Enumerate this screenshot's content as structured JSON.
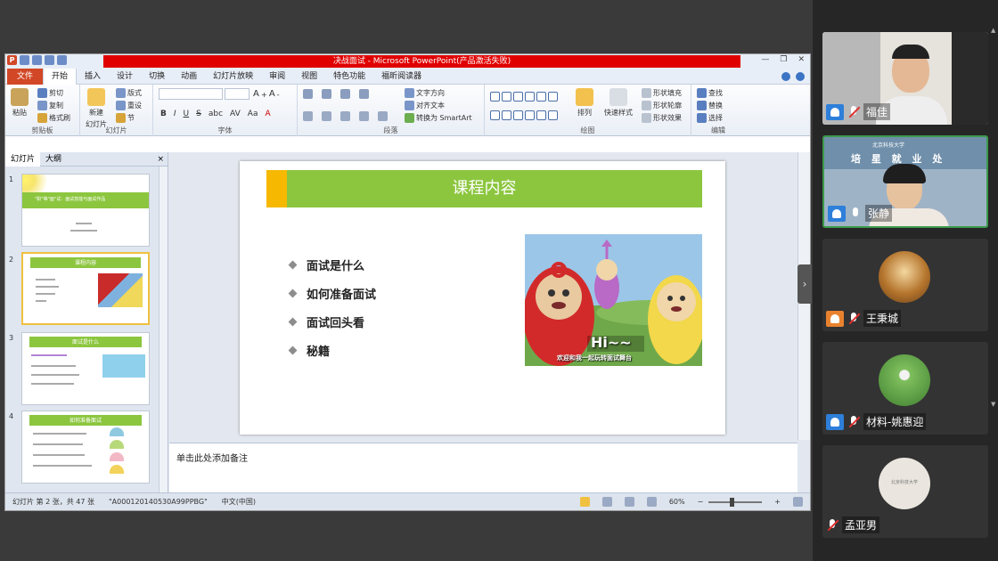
{
  "window": {
    "title": "决战面试 - Microsoft PowerPoint(产品激活失败)"
  },
  "ribbon_tabs": [
    "文件",
    "开始",
    "插入",
    "设计",
    "切换",
    "动画",
    "幻灯片放映",
    "审阅",
    "视图",
    "特色功能",
    "福昕阅读器"
  ],
  "ribbon": {
    "clipboard": {
      "paste": "粘贴",
      "cut": "剪切",
      "copy": "复制",
      "format_painter": "格式刷",
      "label": "剪贴板"
    },
    "slides": {
      "new_slide": "新建",
      "new_slide2": "幻灯片",
      "layout": "版式",
      "reset": "重设",
      "section": "节",
      "label": "幻灯片"
    },
    "font": {
      "label": "字体"
    },
    "paragraph": {
      "text_direction": "文字方向",
      "align_text": "对齐文本",
      "smartart": "转换为 SmartArt",
      "label": "段落"
    },
    "drawing": {
      "arrange": "排列",
      "quick_styles": "快速样式",
      "shape_fill": "形状填充",
      "shape_outline": "形状轮廓",
      "shape_effects": "形状效果",
      "label": "绘图"
    },
    "editing": {
      "find": "查找",
      "replace": "替换",
      "select": "选择",
      "label": "编辑"
    }
  },
  "thumb_pane": {
    "tab_slides": "幻灯片",
    "tab_outline": "大纲",
    "close": "×",
    "slide_numbers": [
      "1",
      "2",
      "3",
      "4"
    ],
    "slide1_title": "\"职\"等\"面\"试：面试技能与面试作品",
    "slide2_title": "课程内容",
    "slide3_title": "面试是什么",
    "slide4_title": "如何准备面试"
  },
  "slide": {
    "title": "课程内容",
    "bullets": [
      "面试是什么",
      "如何准备面试",
      "面试回头看",
      "秘籍"
    ],
    "image_caption": "Hi~~",
    "image_subcaption": "欢迎和我一起玩转面试舞台"
  },
  "notes_placeholder": "单击此处添加备注",
  "status": {
    "slide_info": "幻灯片 第 2 张，共 47 张",
    "theme": "\"A000120140530A99PPBG\"",
    "language": "中文(中国)",
    "zoom": "60%"
  },
  "participants": [
    {
      "name": "福佳",
      "muted": true
    },
    {
      "name": "张静",
      "muted": false,
      "speaking": true
    },
    {
      "name": "王秉城",
      "muted": true
    },
    {
      "name": "材料-姚惠迎",
      "muted": true
    },
    {
      "name": "孟亚男",
      "muted": true
    }
  ],
  "banner_text": "培 星 就 业 处",
  "banner_sub": "北京科技大学",
  "avatar_seal": "北京科技大学"
}
